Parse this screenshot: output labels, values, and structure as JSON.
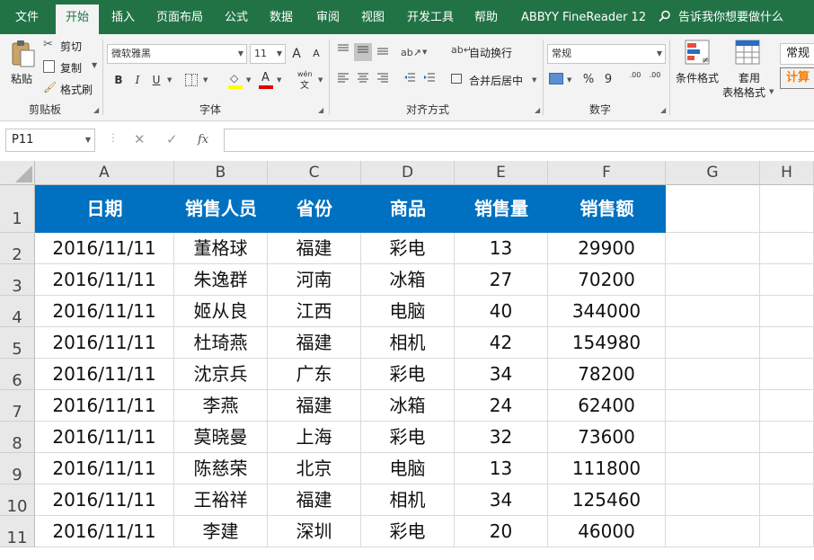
{
  "menu": {
    "tabs": [
      "文件",
      "开始",
      "插入",
      "页面布局",
      "公式",
      "数据",
      "审阅",
      "视图",
      "开发工具",
      "帮助",
      "ABBYY FineReader 12"
    ],
    "active_tab": "开始",
    "search_text": "告诉我你想要做什么"
  },
  "ribbon": {
    "clipboard": {
      "paste": "粘贴",
      "cut": "剪切",
      "copy": "复制",
      "format_painter": "格式刷",
      "group": "剪贴板"
    },
    "font": {
      "name": "微软雅黑",
      "size": "11",
      "bold": "B",
      "italic": "I",
      "underline": "U",
      "grow": "A",
      "shrink": "A",
      "phonetic": "wén",
      "group": "字体"
    },
    "alignment": {
      "wrap_text": "自动换行",
      "merge_center": "合并后居中",
      "group": "对齐方式"
    },
    "number": {
      "format": "常规",
      "percent": "%",
      "comma": "9",
      "inc_decimal": ".00",
      "dec_decimal": ".00",
      "group": "数字"
    },
    "styles": {
      "conditional": "条件格式",
      "table_line1": "套用",
      "table_line2": "表格格式",
      "style_normal": "常规",
      "style_calc": "计算"
    }
  },
  "formula_bar": {
    "name_box": "P11",
    "fx": "fx",
    "cancel": "✕",
    "enter": "✓",
    "value": ""
  },
  "columns": [
    "A",
    "B",
    "C",
    "D",
    "E",
    "F",
    "G",
    "H"
  ],
  "rows": [
    "1",
    "2",
    "3",
    "4",
    "5",
    "6",
    "7",
    "8",
    "9",
    "10",
    "11"
  ],
  "table": {
    "header": [
      "日期",
      "销售人员",
      "省份",
      "商品",
      "销售量",
      "销售额"
    ],
    "rows": [
      [
        "2016/11/11",
        "董格球",
        "福建",
        "彩电",
        "13",
        "29900"
      ],
      [
        "2016/11/11",
        "朱逸群",
        "河南",
        "冰箱",
        "27",
        "70200"
      ],
      [
        "2016/11/11",
        "姬从良",
        "江西",
        "电脑",
        "40",
        "344000"
      ],
      [
        "2016/11/11",
        "杜琦燕",
        "福建",
        "相机",
        "42",
        "154980"
      ],
      [
        "2016/11/11",
        "沈京兵",
        "广东",
        "彩电",
        "34",
        "78200"
      ],
      [
        "2016/11/11",
        "李燕",
        "福建",
        "冰箱",
        "24",
        "62400"
      ],
      [
        "2016/11/11",
        "莫晓曼",
        "上海",
        "彩电",
        "32",
        "73600"
      ],
      [
        "2016/11/11",
        "陈慈荣",
        "北京",
        "电脑",
        "13",
        "111800"
      ],
      [
        "2016/11/11",
        "王裕祥",
        "福建",
        "相机",
        "34",
        "125460"
      ],
      [
        "2016/11/11",
        "李建",
        "深圳",
        "彩电",
        "20",
        "46000"
      ]
    ]
  },
  "colors": {
    "accent": "#217346",
    "header_fill": "#0070c0",
    "header_text": "#ffffff"
  }
}
